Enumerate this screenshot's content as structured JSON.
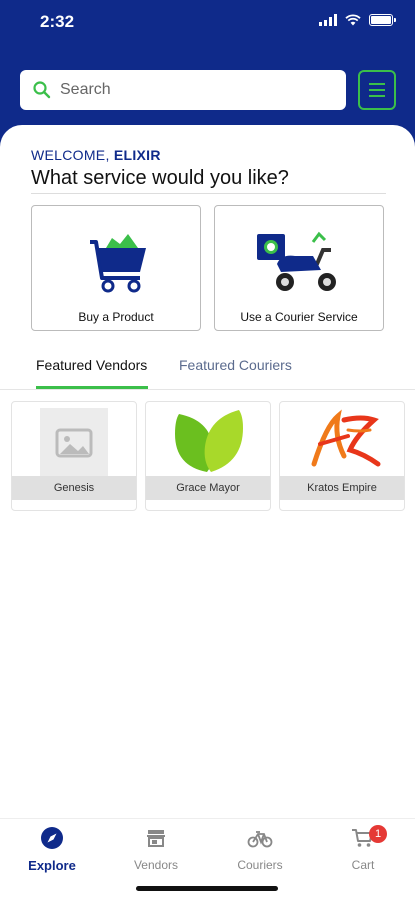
{
  "status": {
    "time": "2:32"
  },
  "search": {
    "placeholder": "Search"
  },
  "welcome": {
    "prefix": "WELCOME,",
    "name": "ELIXIR",
    "question": "What service would you like?"
  },
  "services": [
    {
      "label": "Buy a Product",
      "icon": "shopping-cart-icon"
    },
    {
      "label": "Use a Courier Service",
      "icon": "scooter-courier-icon"
    }
  ],
  "tabs": [
    {
      "label": "Featured Vendors",
      "active": true
    },
    {
      "label": "Featured Couriers",
      "active": false
    }
  ],
  "vendors": [
    {
      "name": "Genesis",
      "logo": "placeholder-image-icon"
    },
    {
      "name": "Grace Mayor",
      "logo": "green-leaf-logo"
    },
    {
      "name": "Kratos Empire",
      "logo": "kratos-script-logo"
    }
  ],
  "nav": [
    {
      "label": "Explore",
      "icon": "compass-icon",
      "active": true
    },
    {
      "label": "Vendors",
      "icon": "store-icon",
      "active": false
    },
    {
      "label": "Couriers",
      "icon": "bicycle-icon",
      "active": false
    },
    {
      "label": "Cart",
      "icon": "cart-icon",
      "active": false,
      "badge": "1"
    }
  ],
  "colors": {
    "primary": "#0f2a8a",
    "accent": "#3bbf4a",
    "badge": "#e53935"
  }
}
